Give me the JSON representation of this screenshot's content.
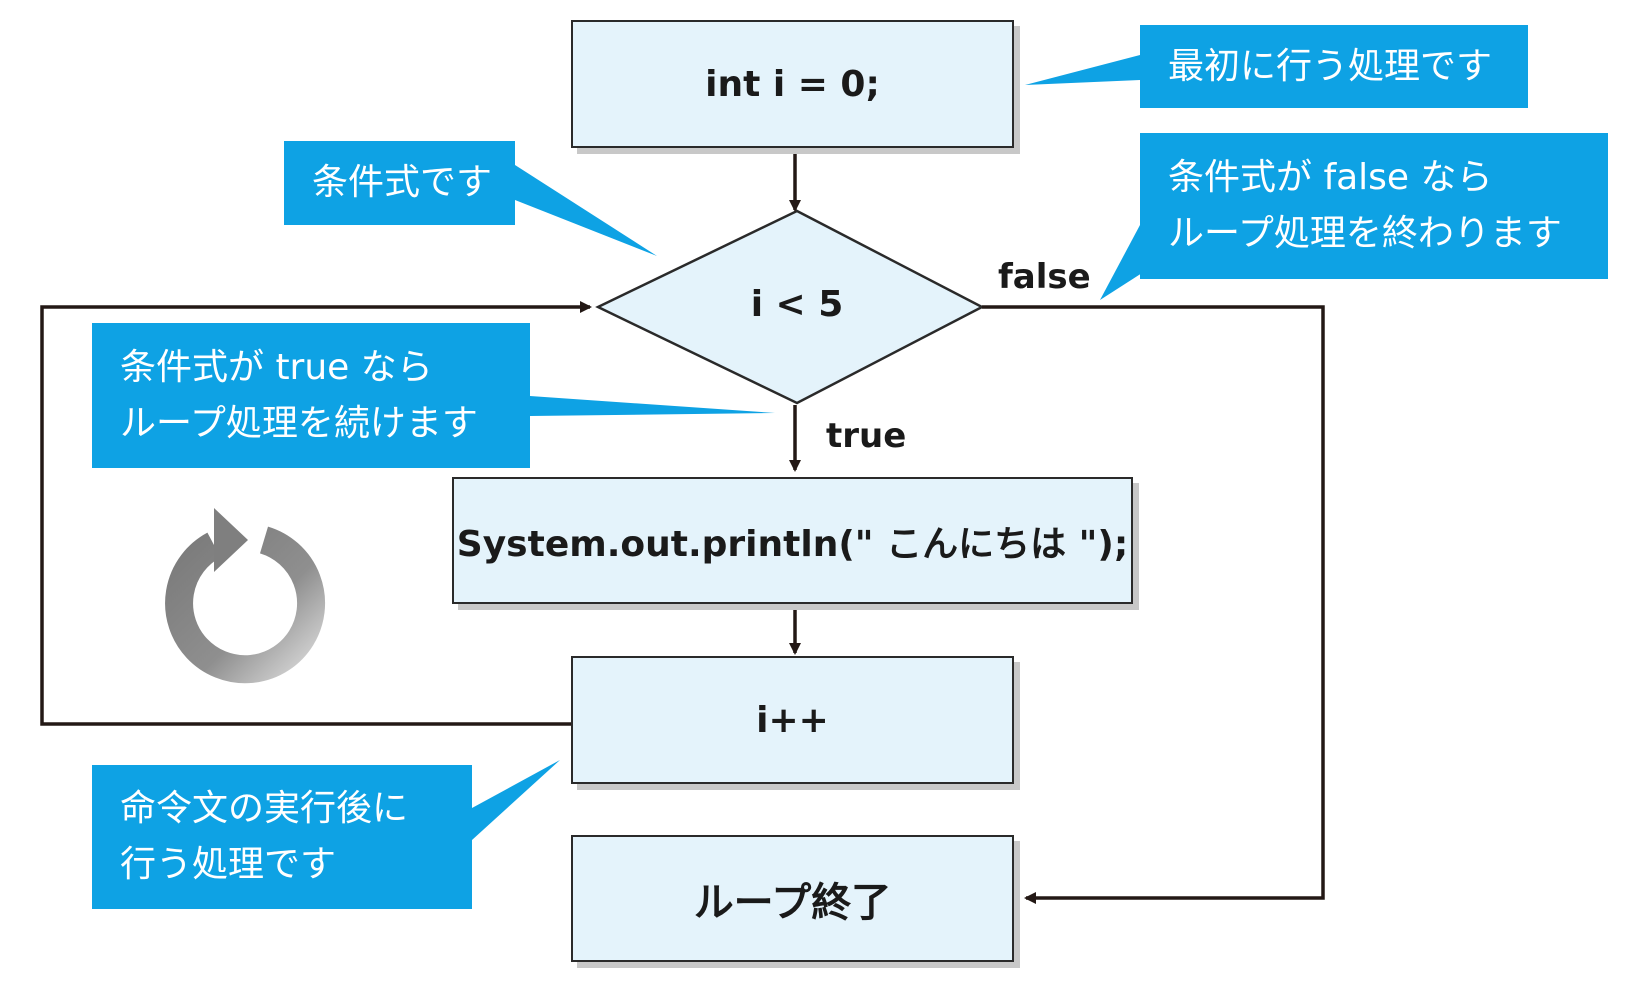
{
  "colors": {
    "box_fill": "#e4f3fb",
    "box_border": "#2a2a2a",
    "callout_fill": "#0ea2e4",
    "callout_text": "#ffffff",
    "line": "#231815",
    "loop_icon": "#8a8a8a"
  },
  "nodes": {
    "init": "int i = 0;",
    "condition": "i < 5",
    "body": "System.out.println(\" こんにちは \");",
    "update": "i++",
    "end": "ループ終了"
  },
  "edges": {
    "false_label": "false",
    "true_label": "true"
  },
  "callouts": {
    "init": [
      "最初に行う処理です"
    ],
    "condition": [
      "条件式です"
    ],
    "false_branch": [
      "条件式が false なら",
      "ループ処理を終わります"
    ],
    "true_branch": [
      "条件式が true なら",
      "ループ処理を続けます"
    ],
    "update": [
      "命令文の実行後に",
      "行う処理です"
    ]
  },
  "icons": {
    "loop": "refresh-arrow-icon"
  }
}
